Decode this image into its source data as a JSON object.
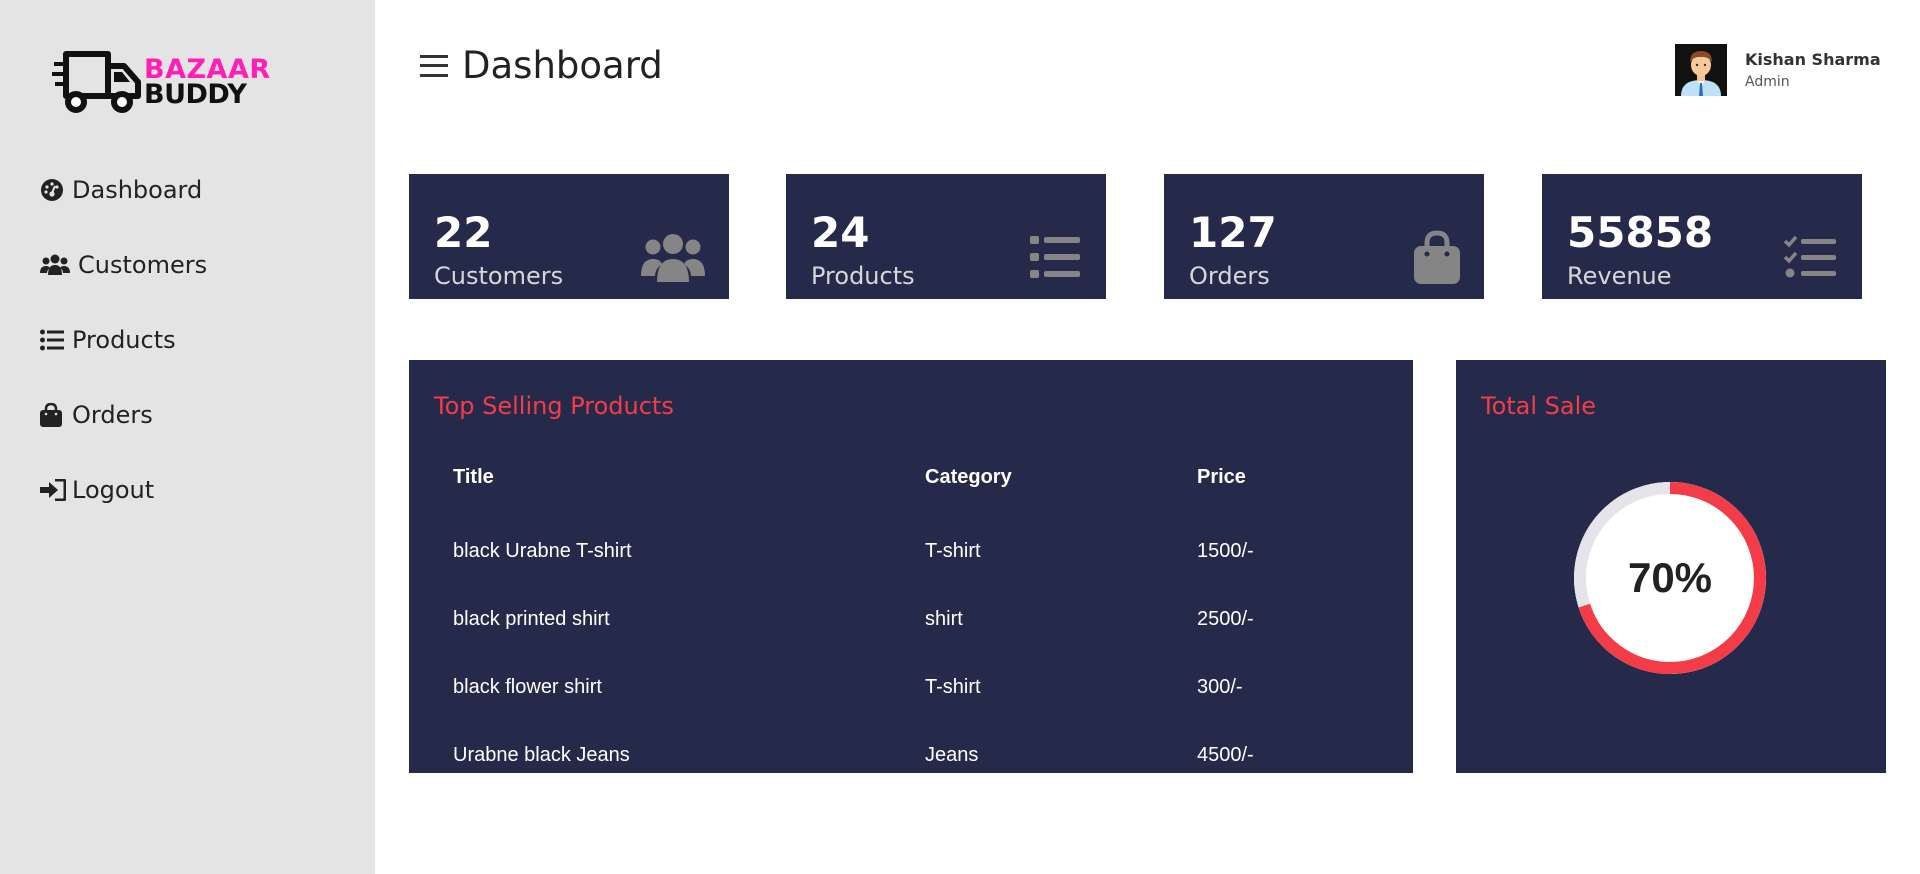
{
  "brand": {
    "line1": "BAZAAR",
    "line2": "BUDDY",
    "line1_color": "#ff1fb4",
    "line2_color": "#111111"
  },
  "sidebar": {
    "items": [
      {
        "label": "Dashboard",
        "icon": "gauge-icon"
      },
      {
        "label": "Customers",
        "icon": "users-icon"
      },
      {
        "label": "Products",
        "icon": "list-icon"
      },
      {
        "label": "Orders",
        "icon": "shopping-bag-icon"
      },
      {
        "label": "Logout",
        "icon": "sign-in-icon"
      }
    ]
  },
  "header": {
    "title": "Dashboard",
    "menu_icon": "hamburger-icon"
  },
  "user": {
    "name": "Kishan Sharma",
    "role": "Admin"
  },
  "stats": [
    {
      "value": "22",
      "label": "Customers",
      "icon": "users-icon"
    },
    {
      "value": "24",
      "label": "Products",
      "icon": "list-icon"
    },
    {
      "value": "127",
      "label": "Orders",
      "icon": "shopping-bag-icon"
    },
    {
      "value": "55858",
      "label": "Revenue",
      "icon": "tasks-icon"
    }
  ],
  "top_selling": {
    "title": "Top Selling Products",
    "columns": [
      "Title",
      "Category",
      "Price"
    ],
    "rows": [
      [
        "black Urabne T-shirt",
        "T-shirt",
        "1500/-"
      ],
      [
        "black printed shirt",
        "shirt",
        "2500/-"
      ],
      [
        "black flower shirt",
        "T-shirt",
        "300/-"
      ],
      [
        "Urabne black Jeans",
        "Jeans",
        "4500/-"
      ]
    ]
  },
  "total_sale": {
    "title": "Total Sale",
    "percent_label": "70%",
    "percent": 70
  },
  "colors": {
    "panel": "#262a4a",
    "accent": "#f33c48",
    "sidebar": "#e4e4e4"
  }
}
